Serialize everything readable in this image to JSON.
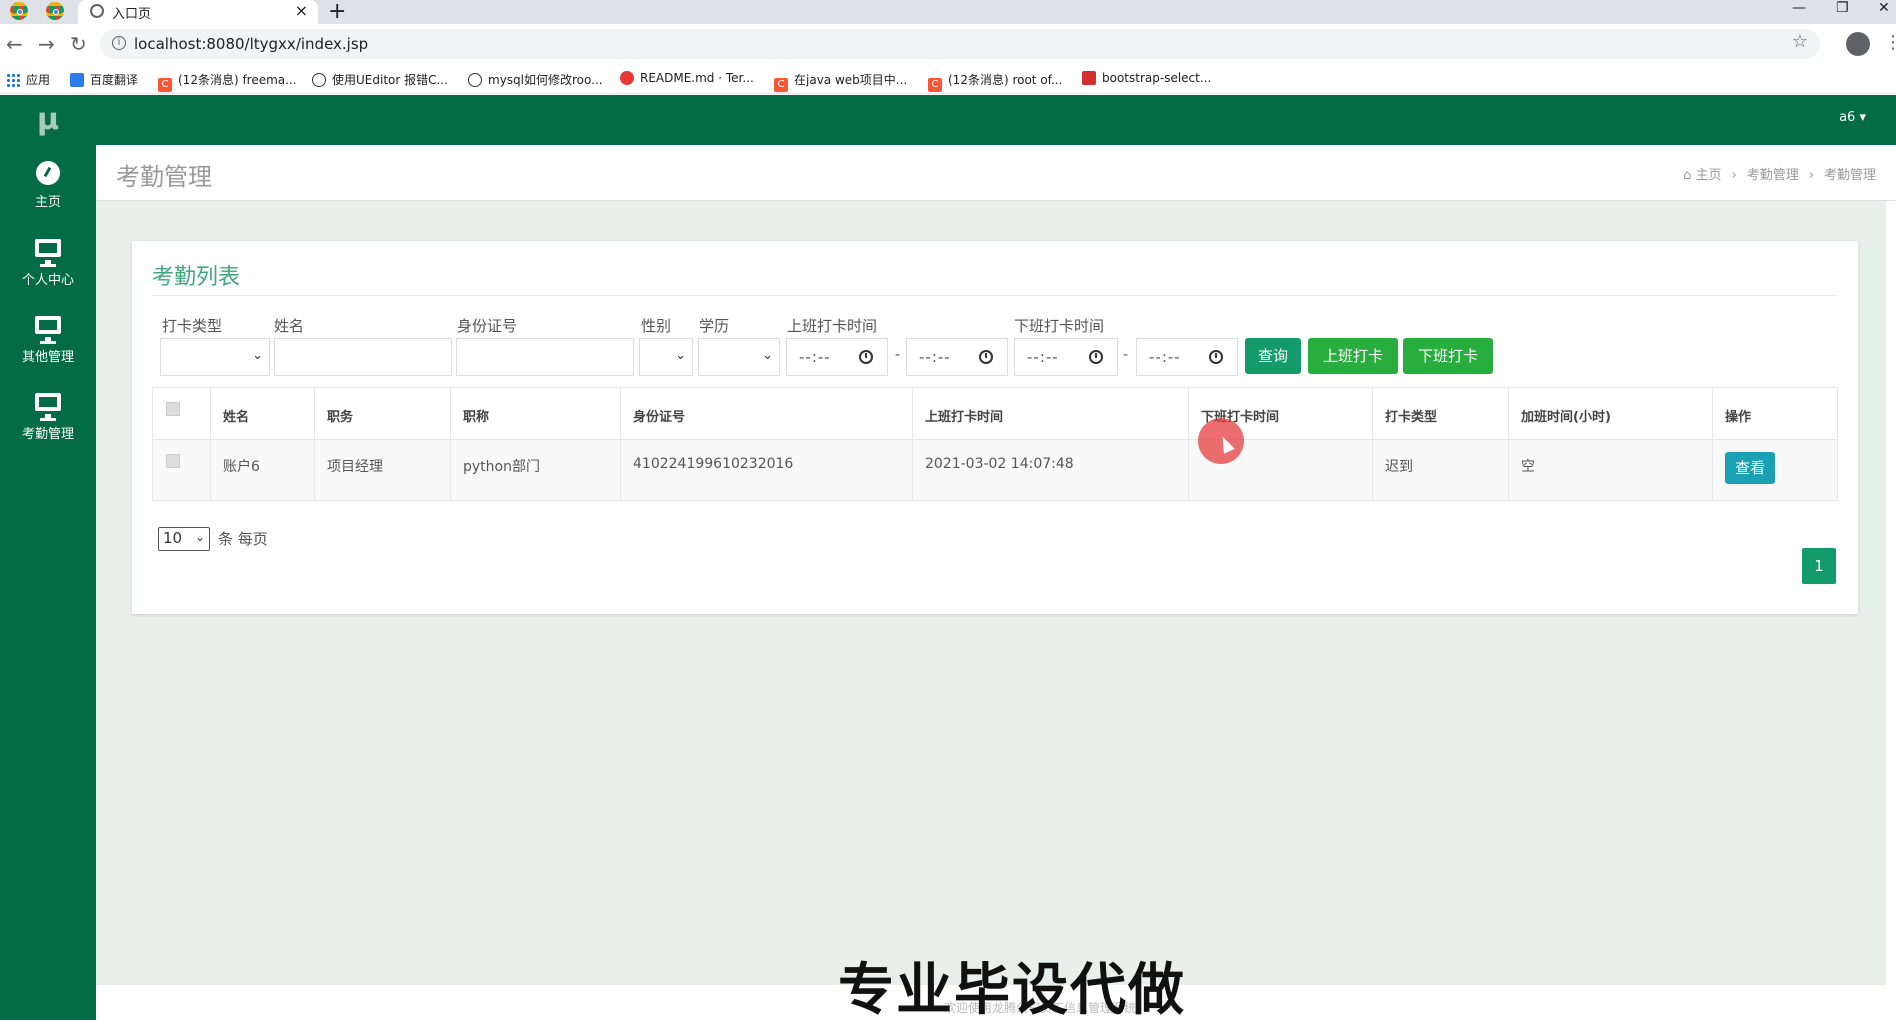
{
  "browser": {
    "active_tab": "入口页",
    "url": "localhost:8080/ltygxx/index.jsp",
    "bookmarks": [
      "应用",
      "百度翻译",
      "(12条消息) freema...",
      "使用UEditor 报错C...",
      "mysql如何修改roo...",
      "README.md · Ter...",
      "在java web项目中...",
      "(12条消息) root of...",
      "bootstrap-select..."
    ]
  },
  "sidebar": {
    "logo": "µ",
    "items": [
      {
        "label": "主页",
        "icon": "dashboard-icon"
      },
      {
        "label": "个人中心",
        "icon": "monitor-icon"
      },
      {
        "label": "其他管理",
        "icon": "monitor-icon"
      },
      {
        "label": "考勤管理",
        "icon": "monitor-icon"
      }
    ]
  },
  "topbar": {
    "user": "a6 ▾"
  },
  "header": {
    "title": "考勤管理",
    "breadcrumb": [
      "主页",
      "考勤管理",
      "考勤管理"
    ]
  },
  "panel": {
    "title": "考勤列表",
    "filters": {
      "punch_type": "打卡类型",
      "name": "姓名",
      "id_number": "身份证号",
      "gender": "性别",
      "education": "学历",
      "checkin_time": "上班打卡时间",
      "checkout_time": "下班打卡时间",
      "time_placeholder": "--:--",
      "range_sep": "-"
    },
    "buttons": {
      "search": "查询",
      "checkin": "上班打卡",
      "checkout": "下班打卡"
    },
    "table": {
      "headers": [
        "姓名",
        "职务",
        "职称",
        "身份证号",
        "上班打卡时间",
        "下班打卡时间",
        "打卡类型",
        "加班时间(小时)",
        "操作"
      ],
      "rows": [
        {
          "name": "账户6",
          "position": "项目经理",
          "title": "python部门",
          "id_number": "410224199610232016",
          "checkin": "2021-03-02 14:07:48",
          "checkout": "",
          "type": "迟到",
          "overtime": "空",
          "action": "查看"
        }
      ]
    },
    "page_size": "10",
    "per_page_label": "条 每页",
    "current_page": "1"
  },
  "footer": {
    "text": "欢迎使用龙腾公司员工信息管理系统"
  },
  "watermark": "专业毕设代做"
}
